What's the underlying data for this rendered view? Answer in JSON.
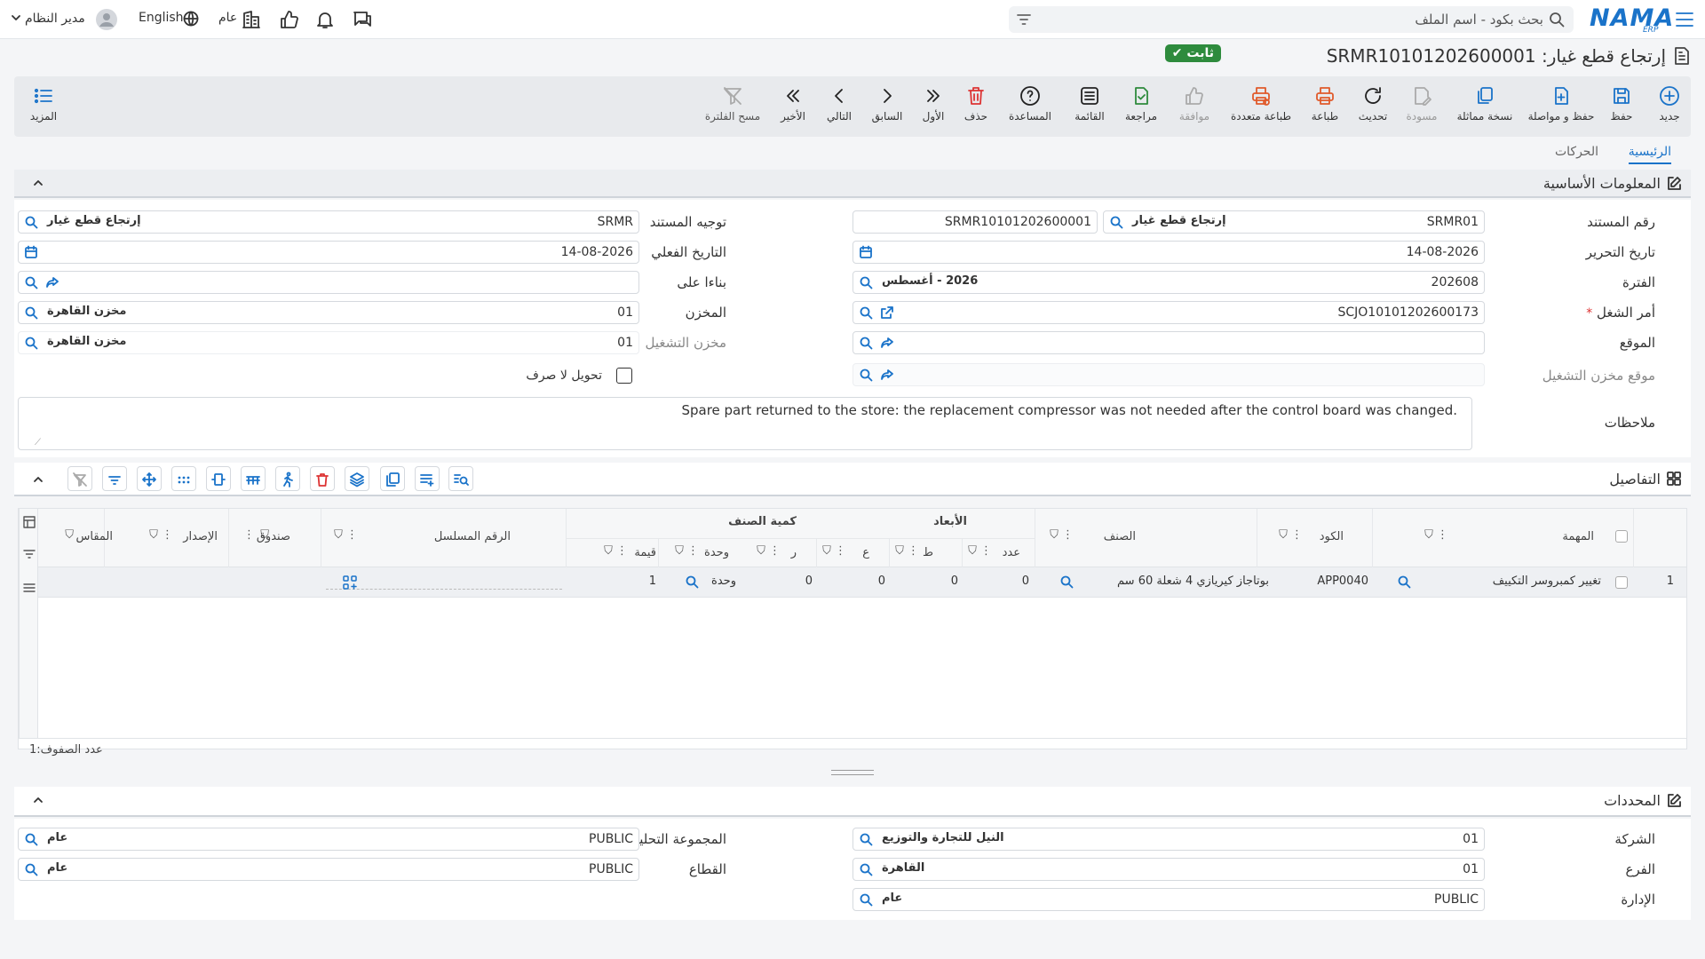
{
  "topbar": {
    "search_placeholder": "بحث بكود - اسم الملف",
    "logo": "NAMA",
    "logo_sub": "ERP",
    "language": "English",
    "scope": "عام",
    "user": "مدير النظام"
  },
  "title": {
    "text": "إرتجاع قطع غيار: SRMR10101202600001",
    "status": "ثابت"
  },
  "toolbar": {
    "new": "جديد",
    "save": "حفظ",
    "save_continue": "حفظ و مواصلة",
    "duplicate": "نسخة مماثلة",
    "draft": "مسودة",
    "refresh": "تحديث",
    "print": "طباعة",
    "multi_print": "طباعة متعددة",
    "approve": "موافقة",
    "review": "مراجعة",
    "list": "القائمة",
    "help": "المساعدة",
    "delete": "حذف",
    "first": "الأول",
    "previous": "السابق",
    "next": "التالي",
    "last": "الأخير",
    "clear_filter": "مسح الفلترة",
    "more": "المزيد"
  },
  "tabs": [
    "الرئيسية",
    "الحركات"
  ],
  "basic": {
    "section_title": "المعلومات الأساسية",
    "doc_number": {
      "label": "رقم المستند",
      "code": "SRMR01",
      "name": "إرتجاع قطع غيار",
      "serial": "SRMR10101202600001"
    },
    "edit_date": {
      "label": "تاريخ التحرير",
      "value": "14-08-2026"
    },
    "period": {
      "label": "الفترة",
      "code": "202608",
      "name": "2026 - أغسطس"
    },
    "work_order": {
      "label": "أمر الشغل",
      "required": "*",
      "value": "SCJO10101202600173"
    },
    "location": {
      "label": "الموقع",
      "value": ""
    },
    "op_location": {
      "label": "موقع مخزن التشغيل",
      "value": ""
    },
    "doc_direction": {
      "label": "توجيه المستند",
      "code": "SRMR",
      "name": "إرتجاع قطع غيار"
    },
    "actual_date": {
      "label": "التاريخ الفعلي",
      "value": "14-08-2026"
    },
    "based_on": {
      "label": "بناءا على",
      "value": ""
    },
    "store": {
      "label": "المخزن",
      "code": "01",
      "name": "مخزن القاهرة"
    },
    "op_store": {
      "label": "مخزن التشغيل",
      "code": "01",
      "name": "مخزن القاهرة"
    },
    "no_issue": {
      "label": "تحويل لا صرف",
      "checked": false
    },
    "notes": {
      "label": "ملاحظات",
      "value": "Spare part returned to the store: the replacement compressor was not needed after the control board was changed."
    }
  },
  "details": {
    "section_title": "التفاصيل",
    "headers": {
      "task": "المهمة",
      "code": "الكود",
      "item": "الصنف",
      "dims": "الأبعاد",
      "count": "عدد",
      "t": "ط",
      "a": "ع",
      "r": "ر",
      "qty": "كمية الصنف",
      "unit": "وحدة",
      "value": "قيمة",
      "serial": "الرقم المسلسل",
      "box": "صندوق",
      "issue": "الإصدار",
      "size": "المقاس"
    },
    "rows": [
      {
        "no": "1",
        "task": "تغيير كمبروسر التكييف",
        "code": "APP0040",
        "item": "بوتاجاز كيريازي 4 شعلة 60 سم",
        "count": "0",
        "t": "0",
        "a": "0",
        "r": "0",
        "unit": "وحدة",
        "value": "1"
      }
    ],
    "row_count_label": "عدد الصفوف:",
    "row_count": "1"
  },
  "dimensions": {
    "section_title": "المحددات",
    "company": {
      "label": "الشركة",
      "code": "01",
      "name": "النيل للتجارة والتوزيع"
    },
    "branch": {
      "label": "الفرع",
      "code": "01",
      "name": "القاهرة"
    },
    "department": {
      "label": "الإدارة",
      "code": "PUBLIC",
      "name": "عام"
    },
    "analytic_group": {
      "label": "المجموعة التحليلية",
      "code": "PUBLIC",
      "name": "عام"
    },
    "sector": {
      "label": "القطاع",
      "code": "PUBLIC",
      "name": "عام"
    }
  },
  "colors": {
    "accent": "#1a73c9",
    "status": "#2e8b3d",
    "danger": "#e05a2b"
  }
}
